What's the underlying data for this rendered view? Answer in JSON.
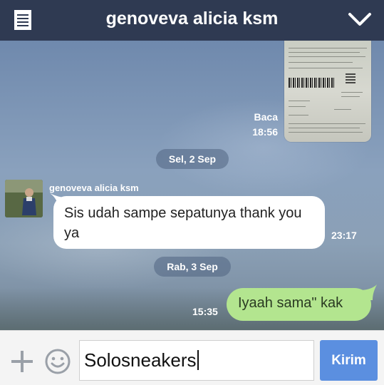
{
  "header": {
    "title": "genoveva alicia ksm",
    "menu_icon": "notes-icon",
    "collapse_icon": "chevron-down-icon"
  },
  "messages": {
    "image_message": {
      "read_label": "Baca",
      "time": "18:56"
    },
    "date_separators": [
      "Sel, 2 Sep",
      "Rab, 3 Sep"
    ],
    "incoming": {
      "sender": "genoveva alicia ksm",
      "text": "Sis udah sampe sepatunya thank you ya",
      "time": "23:17"
    },
    "outgoing": {
      "text": "Iyaah sama\" kak",
      "time": "15:35"
    }
  },
  "composer": {
    "value": "Solosneakers",
    "send_label": "Kirim",
    "plus_icon": "plus-icon",
    "emoji_icon": "smiley-icon"
  },
  "colors": {
    "header_bg": "#2f3a52",
    "outgoing_bubble": "#b3e58f",
    "send_button": "#5b8fe0"
  }
}
